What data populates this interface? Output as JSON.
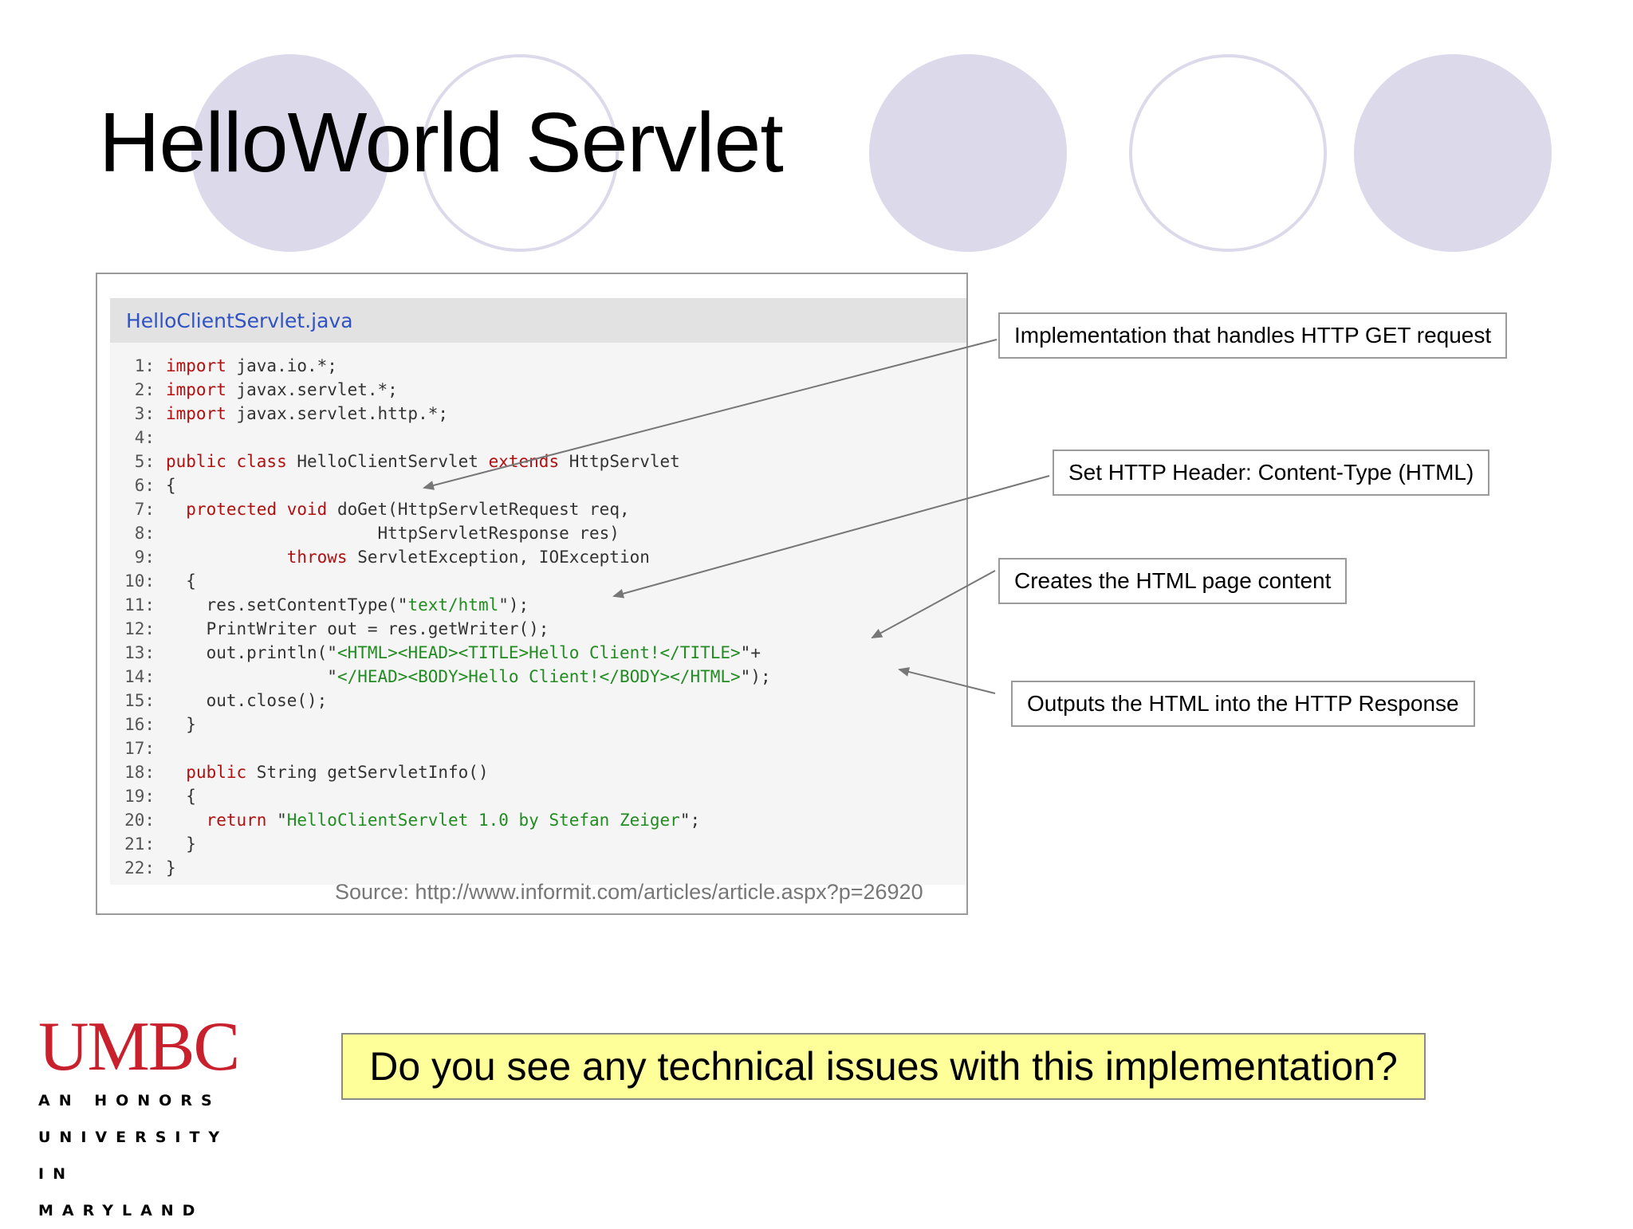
{
  "slide": {
    "title": "HelloWorld Servlet",
    "question": "Do you see any technical issues with this implementation?",
    "source": "Source: http://www.informit.com/articles/article.aspx?p=26920"
  },
  "code": {
    "filename": "HelloClientServlet.java",
    "lines": [
      {
        "num": "1:",
        "segments": [
          {
            "t": "import",
            "c": "kw"
          },
          {
            "t": " java.io.*;",
            "c": ""
          }
        ]
      },
      {
        "num": "2:",
        "segments": [
          {
            "t": "import",
            "c": "kw"
          },
          {
            "t": " javax.servlet.*;",
            "c": ""
          }
        ]
      },
      {
        "num": "3:",
        "segments": [
          {
            "t": "import",
            "c": "kw"
          },
          {
            "t": " javax.servlet.http.*;",
            "c": ""
          }
        ]
      },
      {
        "num": "4:",
        "segments": []
      },
      {
        "num": "5:",
        "segments": [
          {
            "t": "public class",
            "c": "kw"
          },
          {
            "t": " HelloClientServlet ",
            "c": ""
          },
          {
            "t": "extends",
            "c": "kw"
          },
          {
            "t": " HttpServlet",
            "c": ""
          }
        ]
      },
      {
        "num": "6:",
        "segments": [
          {
            "t": "{",
            "c": ""
          }
        ]
      },
      {
        "num": "7:",
        "segments": [
          {
            "t": "  ",
            "c": ""
          },
          {
            "t": "protected void",
            "c": "kw"
          },
          {
            "t": " doGet(HttpServletRequest req,",
            "c": ""
          }
        ]
      },
      {
        "num": "8:",
        "segments": [
          {
            "t": "                     HttpServletResponse res)",
            "c": ""
          }
        ]
      },
      {
        "num": "9:",
        "segments": [
          {
            "t": "            ",
            "c": ""
          },
          {
            "t": "throws",
            "c": "kw"
          },
          {
            "t": " ServletException, IOException",
            "c": ""
          }
        ]
      },
      {
        "num": "10:",
        "segments": [
          {
            "t": "  {",
            "c": ""
          }
        ]
      },
      {
        "num": "11:",
        "segments": [
          {
            "t": "    res.setContentType(\"",
            "c": ""
          },
          {
            "t": "text/html",
            "c": "str"
          },
          {
            "t": "\");",
            "c": ""
          }
        ]
      },
      {
        "num": "12:",
        "segments": [
          {
            "t": "    PrintWriter out = res.getWriter();",
            "c": ""
          }
        ]
      },
      {
        "num": "13:",
        "segments": [
          {
            "t": "    out.println(\"",
            "c": ""
          },
          {
            "t": "<HTML><HEAD><TITLE>Hello Client!</TITLE>",
            "c": "str"
          },
          {
            "t": "\"+",
            "c": ""
          }
        ]
      },
      {
        "num": "14:",
        "segments": [
          {
            "t": "                \"",
            "c": ""
          },
          {
            "t": "</HEAD><BODY>Hello Client!</BODY></HTML>",
            "c": "str"
          },
          {
            "t": "\");",
            "c": ""
          }
        ]
      },
      {
        "num": "15:",
        "segments": [
          {
            "t": "    out.close();",
            "c": ""
          }
        ]
      },
      {
        "num": "16:",
        "segments": [
          {
            "t": "  }",
            "c": ""
          }
        ]
      },
      {
        "num": "17:",
        "segments": []
      },
      {
        "num": "18:",
        "segments": [
          {
            "t": "  ",
            "c": ""
          },
          {
            "t": "public",
            "c": "kw"
          },
          {
            "t": " String getServletInfo()",
            "c": ""
          }
        ]
      },
      {
        "num": "19:",
        "segments": [
          {
            "t": "  {",
            "c": ""
          }
        ]
      },
      {
        "num": "20:",
        "segments": [
          {
            "t": "    ",
            "c": ""
          },
          {
            "t": "return",
            "c": "kw"
          },
          {
            "t": " \"",
            "c": ""
          },
          {
            "t": "HelloClientServlet 1.0 by Stefan Zeiger",
            "c": "str"
          },
          {
            "t": "\";",
            "c": ""
          }
        ]
      },
      {
        "num": "21:",
        "segments": [
          {
            "t": "  }",
            "c": ""
          }
        ]
      },
      {
        "num": "22:",
        "segments": [
          {
            "t": "}",
            "c": ""
          }
        ]
      }
    ]
  },
  "callouts": {
    "get_request": "Implementation that handles HTTP GET request",
    "content_type": "Set HTTP Header: Content-Type (HTML)",
    "page_content": "Creates the HTML page content",
    "output": "Outputs the HTML into the HTTP Response"
  },
  "logo": {
    "name": "UMBC",
    "line1": "AN HONORS",
    "line2": "UNIVERSITY",
    "line3": "IN MARYLAND"
  },
  "colors": {
    "circle": "#dcdaea",
    "keyword": "#b01010",
    "string": "#228b22",
    "filename": "#3152c2",
    "logo": "#c8202c",
    "question_bg": "#ffff99"
  }
}
